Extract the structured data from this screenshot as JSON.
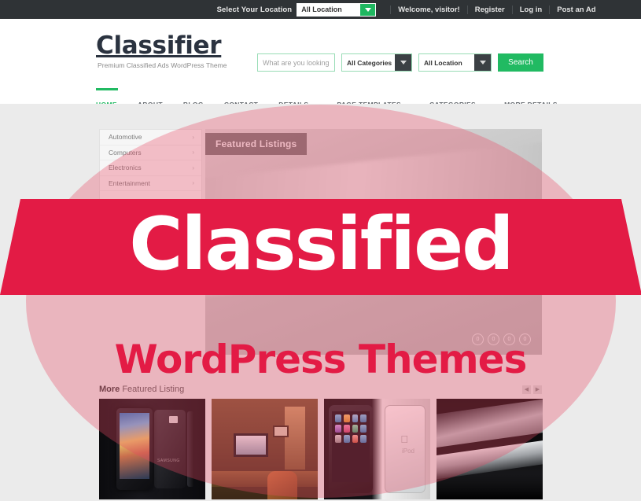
{
  "topbar": {
    "location_label": "Select Your Location",
    "location_value": "All Location",
    "welcome": "Welcome, visitor!",
    "register": "Register",
    "login": "Log in",
    "post_ad": "Post an Ad"
  },
  "header": {
    "logo": "Classifier",
    "tagline": "Premium Classified Ads WordPress Theme",
    "search": {
      "placeholder": "What are you looking for?",
      "category_value": "All Categories",
      "location_value": "All Location",
      "button_label": "Search"
    }
  },
  "nav": {
    "items": [
      {
        "label": "HOME",
        "has_dropdown": false,
        "active": true
      },
      {
        "label": "ABOUT",
        "has_dropdown": false,
        "active": false
      },
      {
        "label": "BLOG",
        "has_dropdown": false,
        "active": false
      },
      {
        "label": "CONTACT",
        "has_dropdown": false,
        "active": false
      },
      {
        "label": "DETAILS",
        "has_dropdown": true,
        "active": false
      },
      {
        "label": "PAGE TEMPLATES",
        "has_dropdown": true,
        "active": false
      },
      {
        "label": "CATEGORIES",
        "has_dropdown": true,
        "active": false
      },
      {
        "label": "MORE DETAILS",
        "has_dropdown": true,
        "active": false
      }
    ]
  },
  "sidebar": {
    "items": [
      {
        "label": "Automotive"
      },
      {
        "label": "Computers"
      },
      {
        "label": "Electronics"
      },
      {
        "label": "Entertainment"
      }
    ],
    "chevron": "›"
  },
  "hero": {
    "badge": "Featured Listings",
    "dots": [
      "0",
      "0",
      "0",
      "0"
    ]
  },
  "more_section": {
    "title_strong": "More",
    "title_rest": " Featured Listing",
    "prev_arrow": "◀",
    "next_arrow": "▶",
    "thumbnails": [
      {
        "name": "samsung-galaxy-phone"
      },
      {
        "name": "office-desk-setup"
      },
      {
        "name": "apple-ipod-touch"
      },
      {
        "name": "laptop-computer"
      }
    ]
  },
  "promo": {
    "banner_text": "Classified",
    "subtitle": "WordPress Themes",
    "banner_color": "#e31b45",
    "ellipse_color": "#eb4864"
  }
}
